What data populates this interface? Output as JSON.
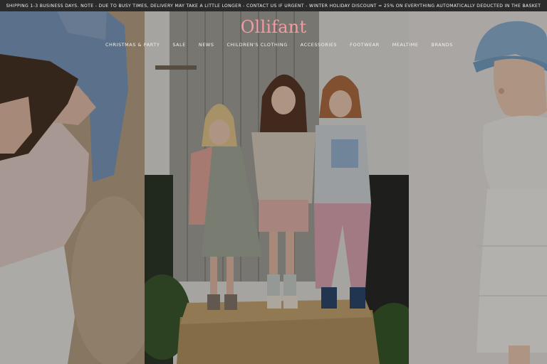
{
  "announcement": "Shipping 1-3 business days. Note - due to busy times, delivery may take a little longer - contact us if urgent - Winter holiday discount = 25% on everything automatically deducted in the basket",
  "brand": {
    "logo_text": "Ollifant",
    "logo_color": "#f39aa2"
  },
  "nav": {
    "items": [
      "Christmas & Party",
      "Sale",
      "News",
      "Children's clothing",
      "Accessories",
      "Footwear",
      "Mealtime",
      "Brands"
    ]
  },
  "hero": {
    "panels": [
      {
        "name": "left-photo",
        "description_icon": "photo-girl-lying-on-sand"
      },
      {
        "name": "center-photo",
        "description_icon": "photo-three-girls-on-hay-bale"
      },
      {
        "name": "right-photo",
        "description_icon": "photo-girl-in-denim-hat"
      }
    ]
  }
}
